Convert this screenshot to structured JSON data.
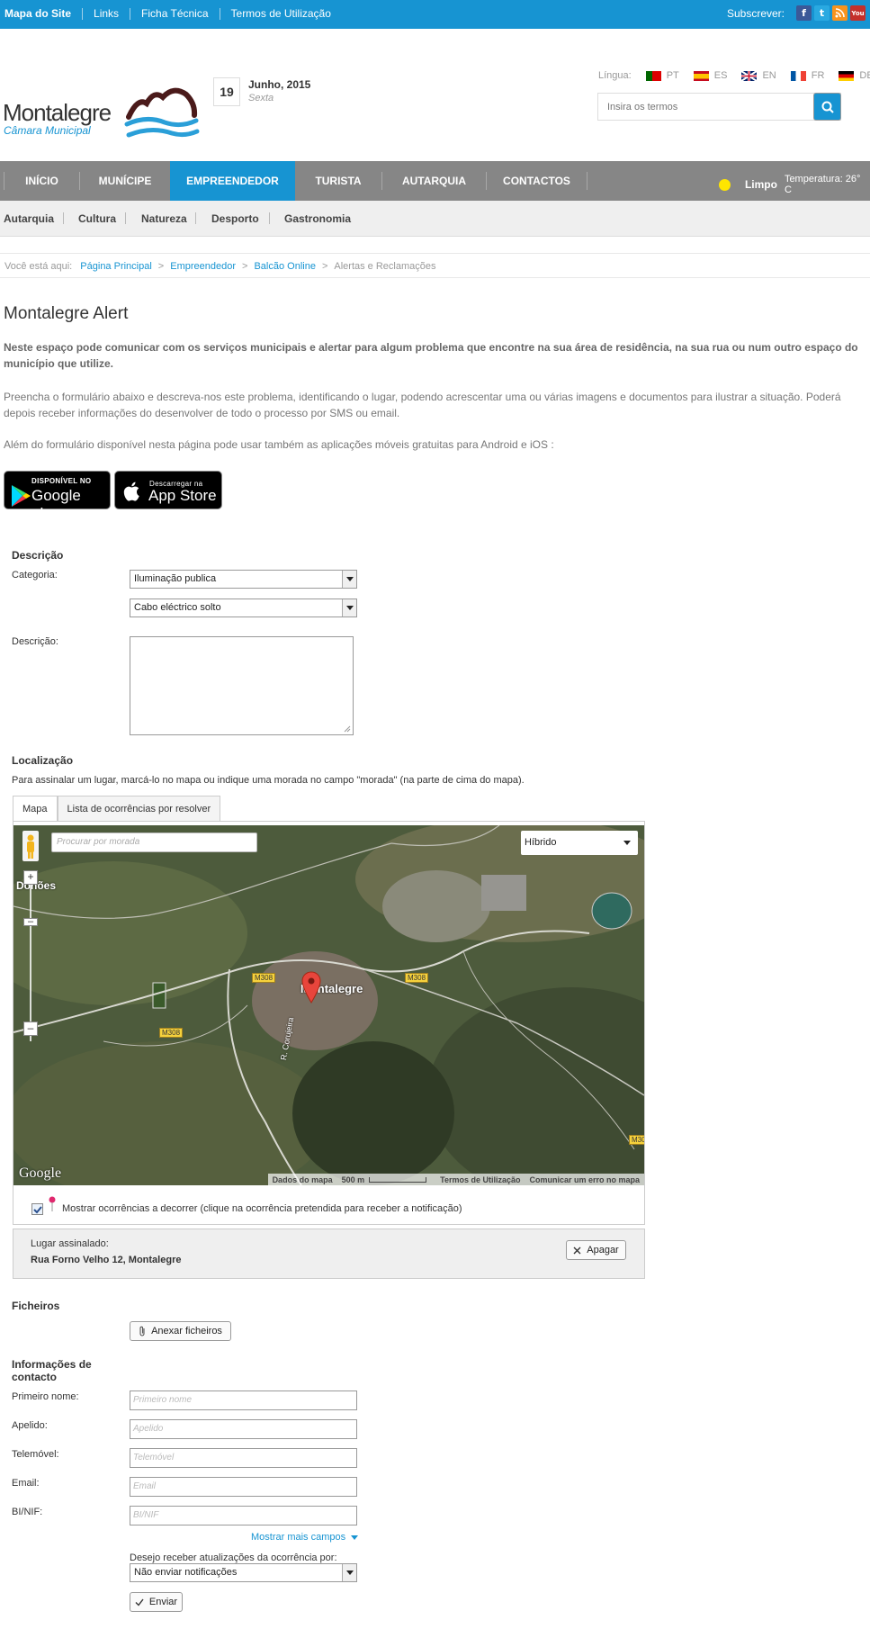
{
  "topbar": {
    "links": [
      "Mapa do Site",
      "Links",
      "Ficha Técnica",
      "Termos de Utilização"
    ],
    "subscribe_label": "Subscrever:",
    "social_icons": [
      "facebook-icon",
      "twitter-icon",
      "rss-icon",
      "youtube-icon"
    ]
  },
  "header": {
    "logo_name": "Montalegre",
    "logo_sub": "Câmara Municipal",
    "day": "19",
    "month_year": "Junho, 2015",
    "weekday": "Sexta",
    "language_label": "Língua:",
    "languages": [
      "PT",
      "ES",
      "EN",
      "FR",
      "DE"
    ],
    "search_placeholder": "Insira os termos"
  },
  "mainnav": {
    "items": [
      "INÍCIO",
      "MUNÍCIPE",
      "EMPREENDEDOR",
      "TURISTA",
      "AUTARQUIA",
      "CONTACTOS"
    ],
    "active": "EMPREENDEDOR",
    "weather": "Limpo",
    "temperature": "Temperatura: 26° C"
  },
  "subnav": {
    "items": [
      "Autarquia",
      "Cultura",
      "Natureza",
      "Desporto",
      "Gastronomia"
    ]
  },
  "breadcrumb": {
    "label": "Você está aqui:",
    "items": [
      "Página Principal",
      "Empreendedor",
      "Balcão Online"
    ],
    "current": "Alertas e Reclamações"
  },
  "content": {
    "title": "Montalegre Alert",
    "intro_bold": "Neste espaço pode comunicar com os serviços municipais e alertar para algum problema que encontre na sua área de residência, na sua rua ou num outro espaço do município que utilize.",
    "intro_text": "Preencha o formulário abaixo e descreva-nos este problema, identificando o lugar, podendo acrescentar uma ou várias imagens e documentos para ilustrar a situação. Poderá depois receber informações do desenvolver de todo o processo por SMS ou email.",
    "apps_text": "Além do formulário disponível nesta página pode usar também as aplicações móveis gratuitas para Android e iOS :",
    "google_play_top": "DISPONÍVEL NO",
    "google_play_name": "Google play",
    "app_store_top": "Descarregar na",
    "app_store_name": "App Store"
  },
  "form": {
    "description_section": "Descrição",
    "category_label": "Categoria:",
    "category_value": "Iluminação publica",
    "subcategory_value": "Cabo eléctrico solto",
    "description_label": "Descrição:",
    "location_section": "Localização",
    "location_help": "Para assinalar um lugar, marcá-lo no mapa ou indique uma morada no campo \"morada\" (na parte de cima do mapa).",
    "tabs": [
      "Mapa",
      "Lista de ocorrências por resolver"
    ],
    "map": {
      "address_placeholder": "Procurar por morada",
      "map_type": "Híbrido",
      "labels": [
        "Donões",
        "Montalegre",
        "R. Corujeira"
      ],
      "roads": [
        "M308",
        "M308",
        "M308",
        "M30"
      ],
      "google": "Google",
      "footer": [
        "Dados do mapa",
        "500 m",
        "Termos de Utilização",
        "Comunicar um erro no mapa"
      ]
    },
    "show_occurrences": "Mostrar ocorrências a decorrer (clique na ocorrência pretendida para receber a notificação)",
    "place_label": "Lugar assinalado:",
    "place_value": "Rua Forno Velho 12, Montalegre",
    "clear_button": "Apagar",
    "files_section": "Ficheiros",
    "attach_button": "Anexar ficheiros",
    "contact_section_1": "Informações de",
    "contact_section_2": "contacto",
    "fields": [
      {
        "label": "Primeiro nome:",
        "placeholder": "Primeiro nome"
      },
      {
        "label": "Apelido:",
        "placeholder": "Apelido"
      },
      {
        "label": "Telemóvel:",
        "placeholder": "Telemóvel"
      },
      {
        "label": "Email:",
        "placeholder": "Email"
      },
      {
        "label": "BI/NIF:",
        "placeholder": "BI/NIF"
      }
    ],
    "more_fields": "Mostrar mais campos",
    "updates_label": "Desejo receber atualizações da ocorrência por:",
    "updates_value": "Não enviar notificações",
    "send_button": "Enviar"
  },
  "colors": {
    "brand_blue": "#1794d2",
    "nav_gray": "#868686"
  }
}
